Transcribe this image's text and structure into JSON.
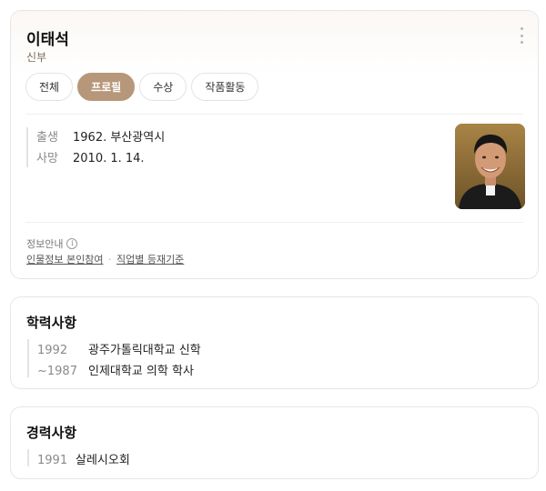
{
  "profile": {
    "name": "이태석",
    "role": "신부",
    "tabs": [
      {
        "label": "전체",
        "active": false
      },
      {
        "label": "프로필",
        "active": true
      },
      {
        "label": "수상",
        "active": false
      },
      {
        "label": "작품활동",
        "active": false
      }
    ],
    "birth_key": "출생",
    "birth_value": "1962. 부산광역시",
    "death_key": "사망",
    "death_value": "2010. 1. 14.",
    "notice_label": "정보안내",
    "link_self": "인물정보 본인참여",
    "link_sep": "·",
    "link_criteria": "직업별 등재기준"
  },
  "education": {
    "title": "학력사항",
    "rows": [
      {
        "year": "1992",
        "text": "광주가톨릭대학교 신학"
      },
      {
        "year": "~1987",
        "text": "인제대학교 의학 학사"
      }
    ]
  },
  "career": {
    "title": "경력사항",
    "rows": [
      {
        "year": "1991",
        "text": "살레시오회"
      }
    ]
  },
  "colors": {
    "accent": "#b79779",
    "border": "#e6e6e6"
  }
}
